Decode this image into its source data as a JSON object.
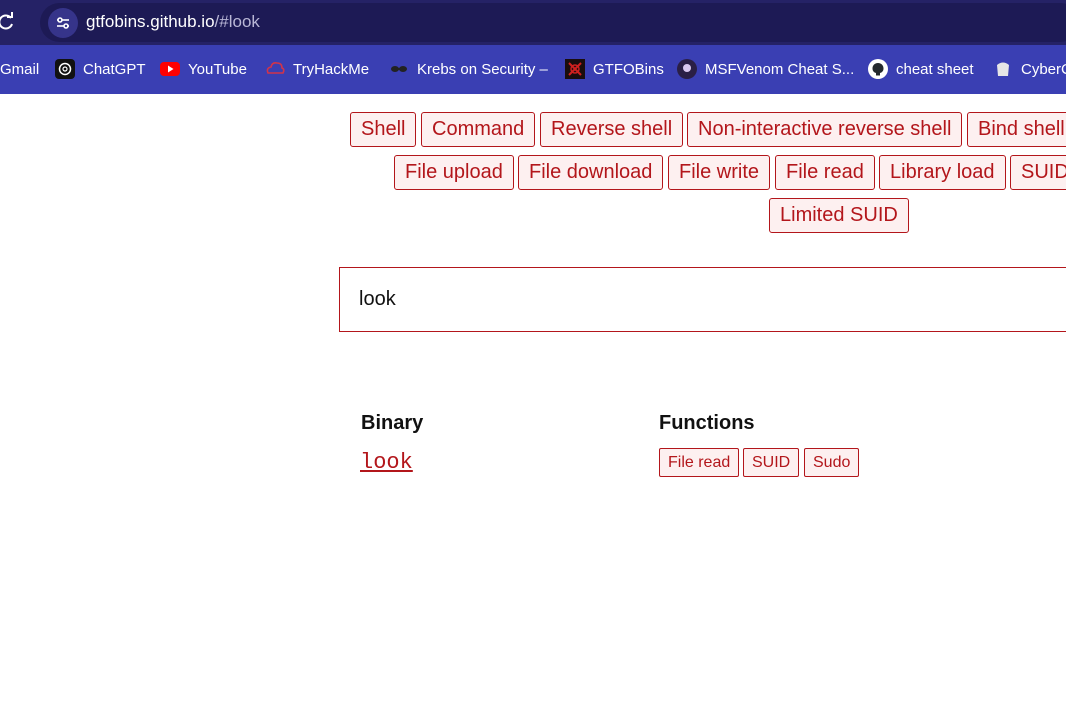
{
  "browser": {
    "url_host": "gtfobins.github.io",
    "url_path": "/#look",
    "bookmarks": [
      {
        "label": "Gmail",
        "icon": "gmail-icon"
      },
      {
        "label": "ChatGPT",
        "icon": "chatgpt-icon"
      },
      {
        "label": "YouTube",
        "icon": "youtube-icon"
      },
      {
        "label": "TryHackMe",
        "icon": "tryhackme-icon"
      },
      {
        "label": "Krebs on Security –",
        "icon": "krebs-icon"
      },
      {
        "label": "GTFOBins",
        "icon": "gtfobins-icon"
      },
      {
        "label": "MSFVenom Cheat S...",
        "icon": "msfvenom-icon"
      },
      {
        "label": "cheat sheet",
        "icon": "github-icon"
      },
      {
        "label": "CyberC",
        "icon": "cyberc-icon"
      }
    ]
  },
  "filters": [
    "Shell",
    "Command",
    "Reverse shell",
    "Non-interactive reverse shell",
    "Bind shell",
    "File upload",
    "File download",
    "File write",
    "File read",
    "Library load",
    "SUID",
    "Limited SUID"
  ],
  "search": {
    "value": "look"
  },
  "results": {
    "header_binary": "Binary",
    "header_functions": "Functions",
    "rows": [
      {
        "binary": "look",
        "functions": [
          "File read",
          "SUID",
          "Sudo"
        ]
      }
    ]
  },
  "colors": {
    "accent": "#b3161b",
    "tag_bg": "#fdf0f0",
    "titlebar": "#252266",
    "bookmarks_bar": "#3a3fb3"
  }
}
